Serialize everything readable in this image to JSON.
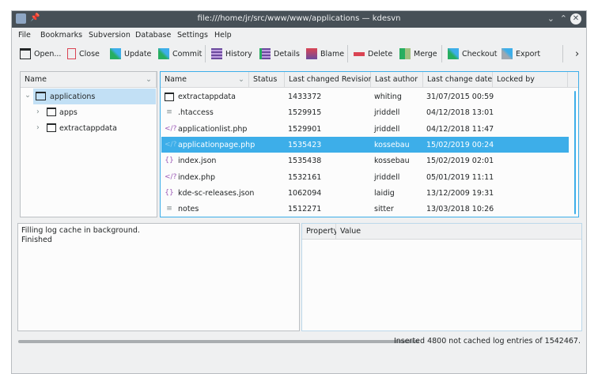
{
  "window": {
    "title": "file:///home/jr/src/www/www/applications — kdesvn"
  },
  "menu": [
    "File",
    "Bookmarks",
    "Subversion",
    "Database",
    "Settings",
    "Help"
  ],
  "toolbar": [
    {
      "label": "Open...",
      "icon": "folder-open-icon"
    },
    {
      "label": "Close",
      "icon": "close-document-icon"
    },
    {
      "label": "Update",
      "icon": "update-icon"
    },
    {
      "label": "Commit",
      "icon": "commit-icon"
    },
    {
      "label": "History",
      "icon": "history-icon"
    },
    {
      "label": "Details",
      "icon": "details-icon"
    },
    {
      "label": "Blame",
      "icon": "blame-icon"
    },
    {
      "label": "Delete",
      "icon": "delete-icon"
    },
    {
      "label": "Merge",
      "icon": "merge-icon"
    },
    {
      "label": "Checkout",
      "icon": "checkout-icon"
    },
    {
      "label": "Export",
      "icon": "export-icon"
    }
  ],
  "tree": {
    "header": "Name",
    "root": "applications",
    "children": [
      "apps",
      "extractappdata"
    ]
  },
  "filelist": {
    "columns": [
      "Name",
      "Status",
      "Last changed Revision",
      "Last author",
      "Last change date",
      "Locked by"
    ],
    "rows": [
      {
        "name": "extractappdata",
        "icon": "folder",
        "rev": "1433372",
        "author": "whiting",
        "date": "31/07/2015 00:59"
      },
      {
        "name": ".htaccess",
        "icon": "text",
        "rev": "1529915",
        "author": "jriddell",
        "date": "04/12/2018 13:01"
      },
      {
        "name": "applicationlist.php",
        "icon": "php",
        "rev": "1529901",
        "author": "jriddell",
        "date": "04/12/2018 11:47"
      },
      {
        "name": "applicationpage.php",
        "icon": "php",
        "rev": "1535423",
        "author": "kossebau",
        "date": "15/02/2019 00:24",
        "selected": true
      },
      {
        "name": "index.json",
        "icon": "json",
        "rev": "1535438",
        "author": "kossebau",
        "date": "15/02/2019 02:01"
      },
      {
        "name": "index.php",
        "icon": "php",
        "rev": "1532161",
        "author": "jriddell",
        "date": "05/01/2019 11:11"
      },
      {
        "name": "kde-sc-releases.json",
        "icon": "json",
        "rev": "1062094",
        "author": "laidig",
        "date": "13/12/2009 19:31"
      },
      {
        "name": "notes",
        "icon": "text",
        "rev": "1512271",
        "author": "sitter",
        "date": "13/03/2018 10:26"
      }
    ]
  },
  "log": [
    "Filling log cache in background.",
    "Finished"
  ],
  "properties": {
    "columns": [
      "Property",
      "Value"
    ]
  },
  "status": {
    "text": "Inserted 4800 not cached log entries of 1542467.",
    "progress": 1.0
  },
  "colors": {
    "accent": "#3daee9",
    "titlebar": "#475057"
  }
}
